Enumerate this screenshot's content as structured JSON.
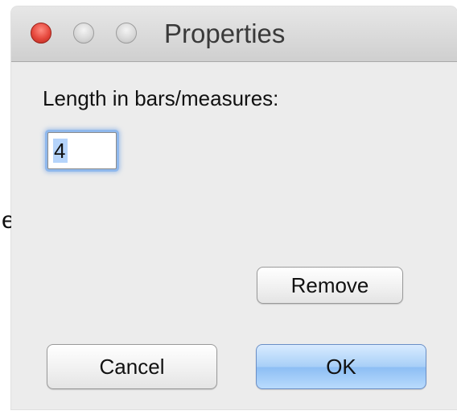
{
  "background": {
    "fragment_text": "e"
  },
  "window": {
    "title": "Properties"
  },
  "form": {
    "length_label": "Length in bars/measures:",
    "length_value": "4"
  },
  "buttons": {
    "remove_label": "Remove",
    "cancel_label": "Cancel",
    "ok_label": "OK"
  },
  "colors": {
    "close_button": "#e5473c",
    "default_button": "#a8cff7",
    "focus_ring": "#8fb8ec"
  }
}
